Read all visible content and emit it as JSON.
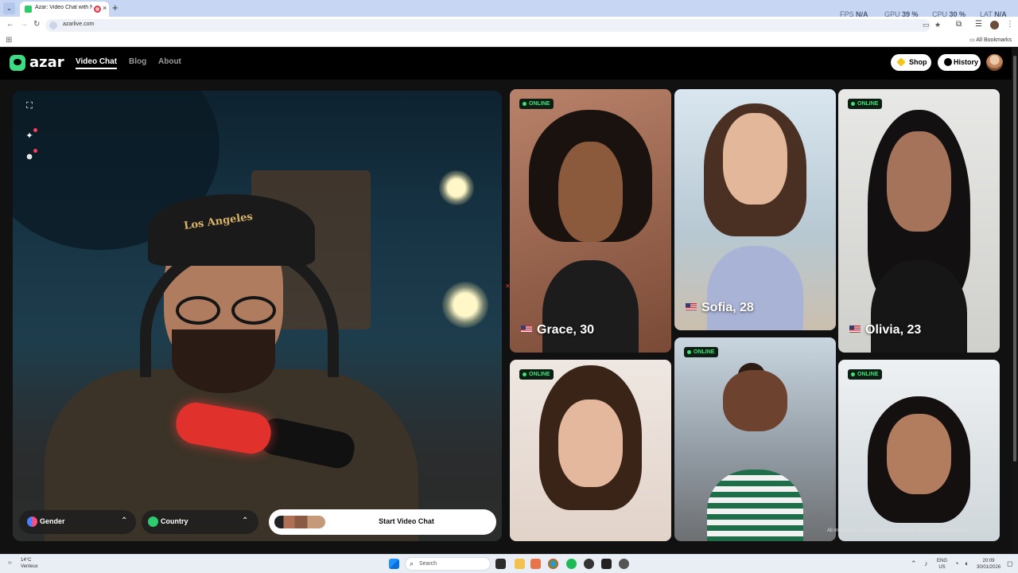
{
  "browser": {
    "tab_title": "Azar: Video Chat with New",
    "tab_close": "×",
    "new_tab": "+",
    "url": "azarlive.com",
    "bookmarks_label": "All Bookmarks"
  },
  "overlay": {
    "fps_label": "FPS",
    "fps_value": "N/A",
    "gpu_label": "GPU",
    "gpu_value": "39 %",
    "cpu_label": "CPU",
    "cpu_value": "30 %",
    "lat_label": "LAT",
    "lat_value": "N/A"
  },
  "site": {
    "logo": "azar",
    "nav": [
      "Video Chat",
      "Blog",
      "About"
    ],
    "shop": "Shop",
    "history": "History"
  },
  "controls": {
    "gender": "Gender",
    "country": "Country",
    "start": "Start Video Chat"
  },
  "online_label": "ONLINE",
  "profiles": [
    {
      "name": "Grace, 30",
      "online": true
    },
    {
      "name": "Sofia, 28",
      "online": false
    },
    {
      "name": "Olivia, 23",
      "online": true
    },
    {
      "name": "",
      "online": true
    },
    {
      "name": "",
      "online": true
    },
    {
      "name": "",
      "online": true
    }
  ],
  "cam": {
    "cap_text": "Los Angeles"
  },
  "disclaimer": "All images are of models and are used for illustrative purposes only.",
  "taskbar": {
    "temp": "14°C",
    "weather": "Venteux",
    "search": "Search",
    "lang": "ENG",
    "region": "US",
    "time": "20:09",
    "date": "30/01/2026"
  }
}
